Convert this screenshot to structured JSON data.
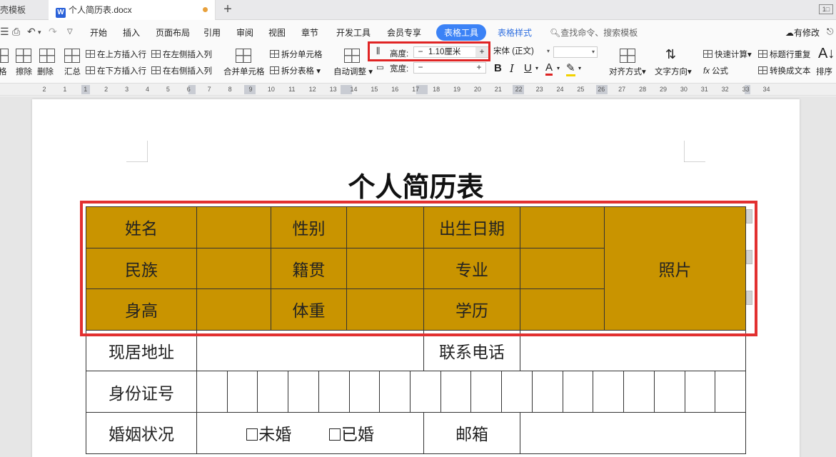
{
  "tabs": {
    "prev_label": "壳模板",
    "active_label": "个人简历表.docx",
    "doc_icon": "W",
    "new_tab": "+",
    "window_btn": "1□"
  },
  "menu": {
    "items": [
      "开始",
      "插入",
      "页面布局",
      "引用",
      "审阅",
      "视图",
      "章节",
      "开发工具",
      "会员专享"
    ],
    "table_tools": "表格工具",
    "table_style": "表格样式",
    "search": "查找命令、搜索模板",
    "revise": "有修改",
    "accent_color": "#3b82f6"
  },
  "ribbon": {
    "erase": "擦除",
    "delete": "删除",
    "summary": "汇总",
    "insert_above": "在上方插入行",
    "insert_below": "在下方插入行",
    "insert_left": "在左侧插入列",
    "insert_right": "在右侧插入列",
    "merge_cells": "合并单元格",
    "split_cells": "拆分单元格",
    "split_table": "拆分表格",
    "auto_adjust": "自动调整",
    "height_label": "高度:",
    "height_value": "1.10厘米",
    "width_label": "宽度:",
    "width_value": "",
    "font_name": "宋体 (正文)",
    "font_size": "",
    "align": "对齐方式",
    "text_direction": "文字方向",
    "quick_calc": "快速计算",
    "repeat_header": "标题行重复",
    "formula": "公式",
    "to_text": "转换成文本",
    "sort": "排序",
    "left_clip": "格"
  },
  "ruler": {
    "numbers": [
      "2",
      "1",
      "1",
      "2",
      "3",
      "4",
      "5",
      "6",
      "7",
      "8",
      "9",
      "10",
      "11",
      "12",
      "13",
      "14",
      "15",
      "16",
      "17",
      "18",
      "19",
      "20",
      "21",
      "22",
      "23",
      "24",
      "25",
      "26",
      "27",
      "28",
      "29",
      "30",
      "31",
      "32",
      "33",
      "34"
    ]
  },
  "document": {
    "title": "个人简历表",
    "highlight_color": "#c99400",
    "rows": [
      [
        "姓名",
        "",
        "性别",
        "",
        "出生日期",
        "",
        "照片"
      ],
      [
        "民族",
        "",
        "籍贯",
        "",
        "专业",
        ""
      ],
      [
        "身高",
        "",
        "体重",
        "",
        "学历",
        ""
      ],
      [
        "现居地址",
        "",
        "联系电话",
        ""
      ],
      [
        "身份证号"
      ],
      [
        "婚姻状况",
        "未婚",
        "已婚",
        "邮箱"
      ]
    ]
  }
}
